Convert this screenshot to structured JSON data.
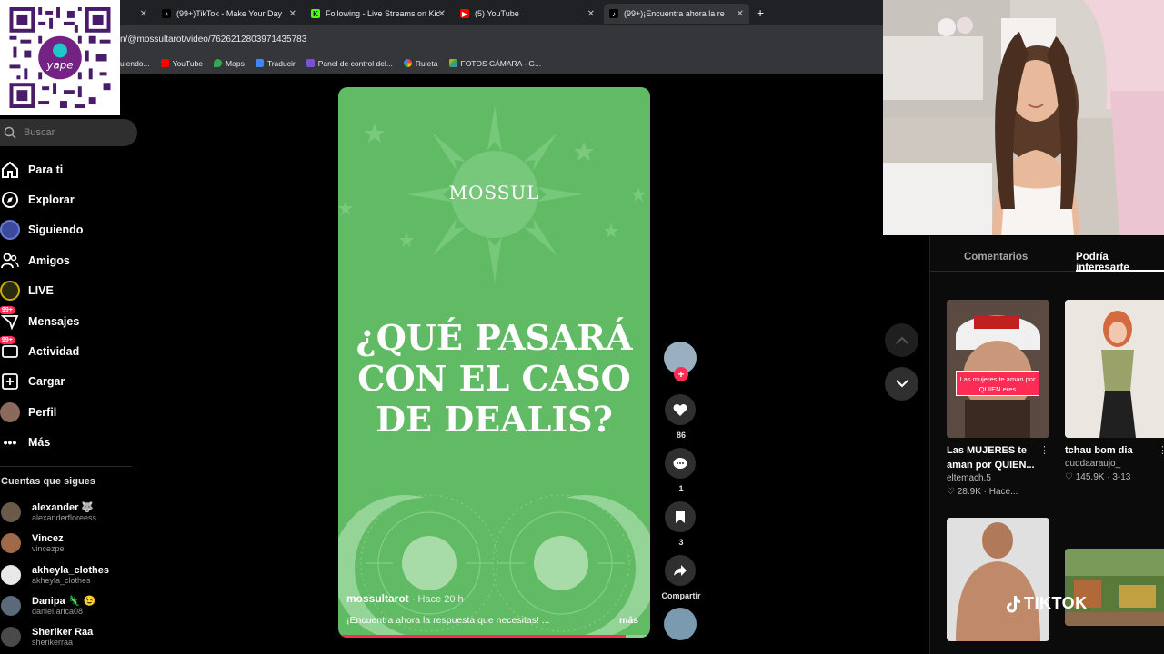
{
  "browser": {
    "tabs": [
      {
        "title": "",
        "icon": "blank-tab-icon"
      },
      {
        "title": "(99+)TikTok - Make Your Day",
        "icon": "tiktok-icon"
      },
      {
        "title": "Following - Live Streams on Kic",
        "icon": "kick-icon"
      },
      {
        "title": "(5) YouTube",
        "icon": "youtube-icon"
      },
      {
        "title": "(99+)¡Encuentra ahora la re",
        "icon": "tiktok-icon",
        "active": true
      }
    ],
    "url": "n/@mossultarot/video/7626212803971435783",
    "bookmarks": [
      {
        "label": "uiendo...",
        "color": "#9aa0a6"
      },
      {
        "label": "YouTube",
        "color": "#ff0000"
      },
      {
        "label": "Maps",
        "color": "#34a853"
      },
      {
        "label": "Traducir",
        "color": "#4285f4"
      },
      {
        "label": "Panel de control del...",
        "color": "#7b4fd6"
      },
      {
        "label": "Ruleta",
        "color": "#ea4335"
      },
      {
        "label": "FOTOS CÁMARA - G...",
        "color": "#fbbc04"
      }
    ]
  },
  "qr": {
    "label": "yape"
  },
  "sidebar": {
    "search_placeholder": "Buscar",
    "nav": [
      {
        "label": "Para ti",
        "icon": "home-icon"
      },
      {
        "label": "Explorar",
        "icon": "compass-icon"
      },
      {
        "label": "Siguiendo",
        "icon": "following-avatar-icon"
      },
      {
        "label": "Amigos",
        "icon": "friends-icon"
      },
      {
        "label": "LIVE",
        "icon": "live-icon"
      },
      {
        "label": "Mensajes",
        "icon": "messages-icon",
        "badge": "99+"
      },
      {
        "label": "Actividad",
        "icon": "activity-icon",
        "badge": "99+"
      },
      {
        "label": "Cargar",
        "icon": "upload-icon"
      },
      {
        "label": "Perfil",
        "icon": "profile-avatar-icon"
      },
      {
        "label": "Más",
        "icon": "more-icon"
      }
    ],
    "following_title": "Cuentas que sigues",
    "following": [
      {
        "name": "alexander 🐺",
        "handle": "alexanderfloreess",
        "color": "#6b5a4a"
      },
      {
        "name": "Vincez",
        "handle": "vincezpe",
        "color": "#a06a4a"
      },
      {
        "name": "akheyla_clothes",
        "handle": "akheyla_clothes",
        "color": "#e8e8e8"
      },
      {
        "name": "Danipa 🦎 😉",
        "handle": "daniel.arica08",
        "color": "#5a6a7a"
      },
      {
        "name": "Sheriker Raa",
        "handle": "sherikerraa",
        "color": "#4a4a4a"
      }
    ]
  },
  "video": {
    "brand": "MOSSUL",
    "headline": [
      "¿QUÉ PASARÁ",
      "CON EL CASO",
      "DE DEALIS?"
    ],
    "author": "mossultarot",
    "time": " · Hace 20 h",
    "description": "¡Encuentra ahora la respuesta que necesitas! ...",
    "more": "más",
    "progress": 0.92,
    "bg_color": "#60bb64"
  },
  "actions": {
    "likes": "86",
    "comments": "1",
    "saves": "3",
    "share_label": "Compartir"
  },
  "right_panel": {
    "tabs": [
      "Comentarios",
      "Podría interesarte"
    ],
    "cards": [
      {
        "title": "Las MUJERES te aman por QUIEN...",
        "user": "eltemach.5",
        "meta": "♡ 28.9K · Hace...",
        "overlay": "Las mujeres te aman por QUIEN eres"
      },
      {
        "title": "tchau bom dia",
        "user": "duddaaraujo_",
        "meta": "♡ 145.9K · 3-13"
      }
    ]
  },
  "watermark": "TIKTOK"
}
